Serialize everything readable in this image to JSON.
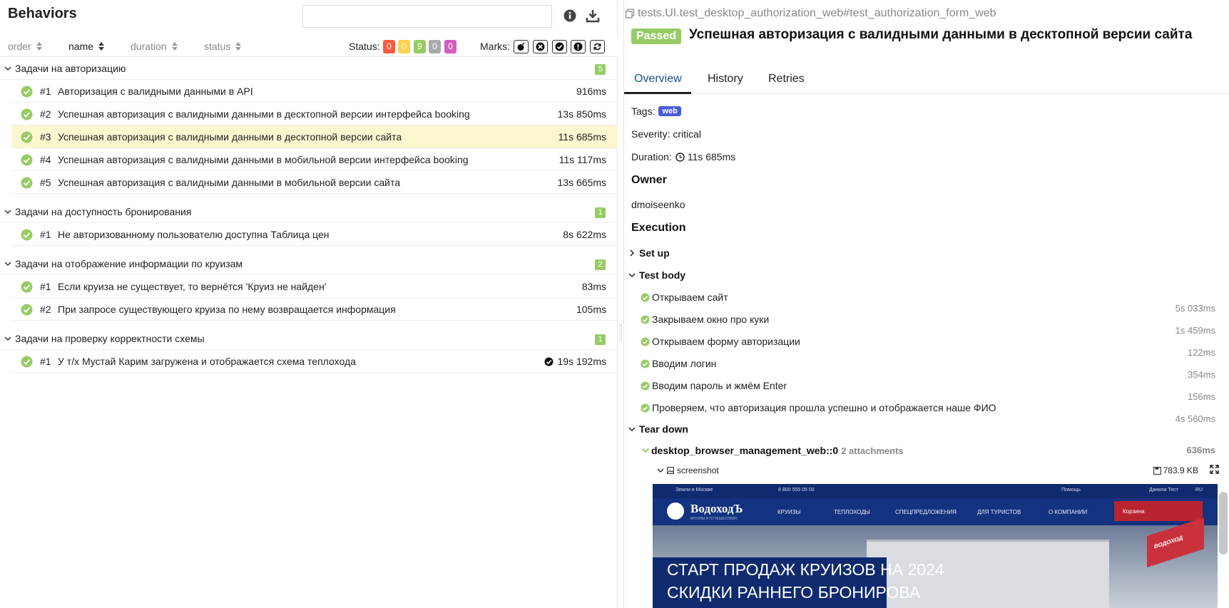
{
  "left": {
    "title": "Behaviors",
    "search_value": "",
    "sort": {
      "order": "order",
      "name": "name",
      "duration": "duration",
      "status": "status"
    },
    "status_label": "Status:",
    "status_counts": [
      {
        "value": "0",
        "color": "#fd5a3e"
      },
      {
        "value": "0",
        "color": "#ffd050"
      },
      {
        "value": "9",
        "color": "#97cc64"
      },
      {
        "value": "0",
        "color": "#aaaaaa"
      },
      {
        "value": "0",
        "color": "#d35ebe"
      }
    ],
    "marks_label": "Marks:",
    "marks": [
      "bomb-icon",
      "close-circle-icon",
      "check-circle-icon",
      "exclamation-icon",
      "refresh-icon"
    ],
    "groups": [
      {
        "name": "Задачи на авторизацию",
        "count": "5",
        "items": [
          {
            "num": "#1",
            "name": "Авторизация с валидными данными в API",
            "dur": "916ms"
          },
          {
            "num": "#2",
            "name": "Успешная авторизация с валидными данными в десктопной версии интерфейса booking",
            "dur": "13s 850ms"
          },
          {
            "num": "#3",
            "name": "Успешная авторизация с валидными данными в десктопной версии сайта",
            "dur": "11s 685ms"
          },
          {
            "num": "#4",
            "name": "Успешная авторизация с валидными данными в мобильной версии интерфейса booking",
            "dur": "11s 117ms"
          },
          {
            "num": "#5",
            "name": "Успешная авторизация с валидными данными в мобильной версии сайта",
            "dur": "13s 665ms"
          }
        ]
      },
      {
        "name": "Задачи на доступность бронирования",
        "count": "1",
        "items": [
          {
            "num": "#1",
            "name": "Не авторизованному пользователю доступна Таблица цен",
            "dur": "8s 622ms"
          }
        ]
      },
      {
        "name": "Задачи на отображение информации по круизам",
        "count": "2",
        "items": [
          {
            "num": "#1",
            "name": "Если круиза не существует, то вернётся 'Круиз не найден'",
            "dur": "83ms"
          },
          {
            "num": "#2",
            "name": "При запросе существующего круиза по нему возвращается информация",
            "dur": "105ms"
          }
        ]
      },
      {
        "name": "Задачи на проверку корректности схемы",
        "count": "1",
        "items": [
          {
            "num": "#1",
            "name": "У т/х Мустай Карим загружена и отображается схема теплохода",
            "dur": "19s 192ms"
          }
        ]
      }
    ]
  },
  "right": {
    "breadcrumb": "tests.UI.test_desktop_authorization_web#test_authorization_form_web",
    "status_badge": "Passed",
    "title": "Успешная авторизация с валидными данными в десктопной версии сайта",
    "tabs": [
      "Overview",
      "History",
      "Retries"
    ],
    "tags_label": "Tags:",
    "tag": "web",
    "severity": "Severity: critical",
    "duration_label": "Duration:",
    "duration": "11s 685ms",
    "owner_heading": "Owner",
    "owner": "dmoiseenko",
    "execution_heading": "Execution",
    "setup": "Set up",
    "test_body": "Test body",
    "steps": [
      {
        "name": "Открываем сайт",
        "dur": "5s 033ms"
      },
      {
        "name": "Закрываем окно про куки",
        "dur": "1s 459ms"
      },
      {
        "name": "Открываем форму авторизации",
        "dur": "122ms"
      },
      {
        "name": "Вводим логин",
        "dur": "354ms"
      },
      {
        "name": "Вводим пароль и жмём Enter",
        "dur": "156ms"
      },
      {
        "name": "Проверяем, что авторизация прошла успешно и отображается наше ФИО",
        "dur": "4s 560ms"
      }
    ],
    "teardown": "Tear down",
    "fixture_name": "desktop_browser_management_web::0",
    "fixture_attachments": "2 attachments",
    "fixture_dur": "636ms",
    "attachment_name": "screenshot",
    "attachment_size": "783.9 KB",
    "screenshot": {
      "top_city": "Земли в Москве",
      "phone": "8 800 555 05 00",
      "rest": "Помощь",
      "user": "Данила Тест",
      "lang": "RU",
      "brand": "ВодоходЪ",
      "brand_sub": "КРУИЗЫ И ПУТЕШЕСТВИЯ",
      "nav": [
        "КРУИЗЫ",
        "ТЕПЛОХОДЫ",
        "СПЕЦПРЕДЛОЖЕНИЯ",
        "ДЛЯ ТУРИСТОВ",
        "О КОМПАНИИ"
      ],
      "cart": "Корзина",
      "flag_text": "ВОДОХОД",
      "promo_line1": "СТАРТ ПРОДАЖ КРУИЗОВ НА 2024",
      "promo_line2": "СКИДКИ РАННЕГО БРОНИРОВА"
    }
  }
}
